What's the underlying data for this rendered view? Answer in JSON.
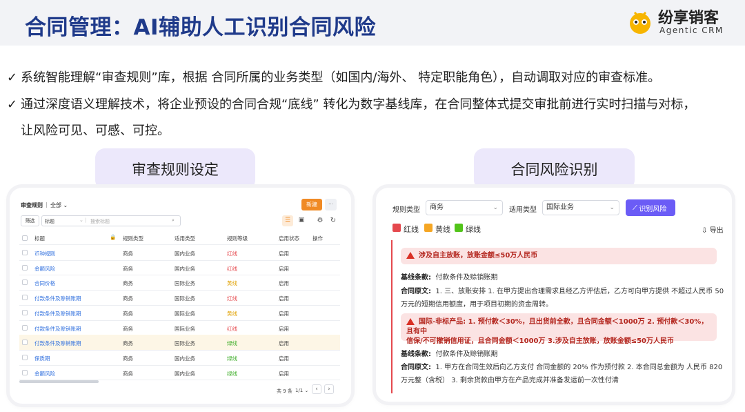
{
  "header": {
    "title": "合同管理：AI辅助人工识别合同风险",
    "logo_text": "纷享销客",
    "logo_sub": "Agentic CRM"
  },
  "bullets": [
    {
      "check": "✓",
      "text": "系统智能理解“审查规则”库，根据 合同所属的业务类型（如国内/海外、 特定职能角色），自动调取对应的审查标准。"
    },
    {
      "check": "✓",
      "text": "通过深度语义理解技术，将企业预设的合同合规“底线” 转化为数字基线库，在合同整体式提交审批前进行实时扫描与对标，",
      "cont": "让风险可见、可感、可控。"
    }
  ],
  "pills": {
    "left": "审查规则设定",
    "right": "合同风险识别"
  },
  "rules_panel": {
    "title": "审查规则",
    "scope": "全部",
    "new_button": "新建",
    "more_button": "···",
    "filter_button": "筛选",
    "field_select": "标题",
    "search_placeholder": "搜索标题",
    "columns": [
      "标题",
      "规则类型",
      "适用类型",
      "规则等级",
      "启用状态",
      "操作"
    ],
    "rows": [
      {
        "title": "币种规则",
        "rule_type": "商务",
        "apply": "国内业务",
        "level": "红线",
        "status": "启用"
      },
      {
        "title": "金额风险",
        "rule_type": "商务",
        "apply": "国内业务",
        "level": "红线",
        "status": "启用"
      },
      {
        "title": "合同价格",
        "rule_type": "商务",
        "apply": "国际业务",
        "level": "黄线",
        "status": "启用"
      },
      {
        "title": "付款条件及赊销账期",
        "rule_type": "商务",
        "apply": "国际业务",
        "level": "红线",
        "status": "启用"
      },
      {
        "title": "付款条件及赊销账期",
        "rule_type": "商务",
        "apply": "国际业务",
        "level": "黄线",
        "status": "启用"
      },
      {
        "title": "付款条件及赊销账期",
        "rule_type": "商务",
        "apply": "国际业务",
        "level": "红线",
        "status": "启用"
      },
      {
        "title": "付款条件及赊销账期",
        "rule_type": "商务",
        "apply": "国际业务",
        "level": "绿线",
        "status": "启用"
      },
      {
        "title": "保质期",
        "rule_type": "商务",
        "apply": "国内业务",
        "level": "绿线",
        "status": "启用"
      },
      {
        "title": "金额风险",
        "rule_type": "商务",
        "apply": "国内业务",
        "level": "绿线",
        "status": "启用"
      }
    ],
    "pagination": {
      "total": "共 9 条",
      "page": "1/1",
      "prev": "‹",
      "next": "›"
    }
  },
  "risk_panel": {
    "rule_type_label": "规则类型",
    "rule_type_value": "商务",
    "apply_label": "适用类型",
    "apply_value": "国际业务",
    "identify_button": "识别风险",
    "export_label": "导出",
    "legend": [
      {
        "label": "红线",
        "color": "#e5484d"
      },
      {
        "label": "黄线",
        "color": "#f5a623"
      },
      {
        "label": "绿线",
        "color": "#52c41a"
      }
    ],
    "risks": [
      {
        "banner": "涉及自主放账，放账金额≤50万人民币",
        "clause_label": "基线条款:",
        "clause_value": "付款条件及赊销账期",
        "original_label": "合同原文:",
        "original_line1": "1. 三、放账安排 1. 在甲方提出合理需求且经乙方评估后，乙方可向甲方提供 不超过人民币 50",
        "original_line2": "万元的短期信用额度，用于项目初期的资金周转。"
      },
      {
        "banner_line1": "国际-非标产品:  1. 预付款＜30%，且出货前全款，且合同金额＜1000万 2. 预付款＜30%，且有中",
        "banner_line2": "信保/不可撤销信用证，且合同金额＜1000万 3.涉及自主放账，放账金额≤50万人民币",
        "clause_label": "基线条款:",
        "clause_value": "付款条件及赊销账期",
        "original_label": "合同原文:",
        "original_line1": "1. 甲方在合同生效后向乙方支付 合同金额的 20% 作为预付款 2. 本合同总金额为 人民币 820",
        "original_line2": "万元整（含税） 3. 剩余货款由甲方在产品完成并准备发运前一次性付清"
      }
    ]
  },
  "colors": {
    "title_blue": "#1f3a8a",
    "accent_orange": "#f08a24",
    "purple": "#6b5cf6",
    "red": "#d93025",
    "yellow": "#e0a100",
    "green": "#3fae2a"
  }
}
